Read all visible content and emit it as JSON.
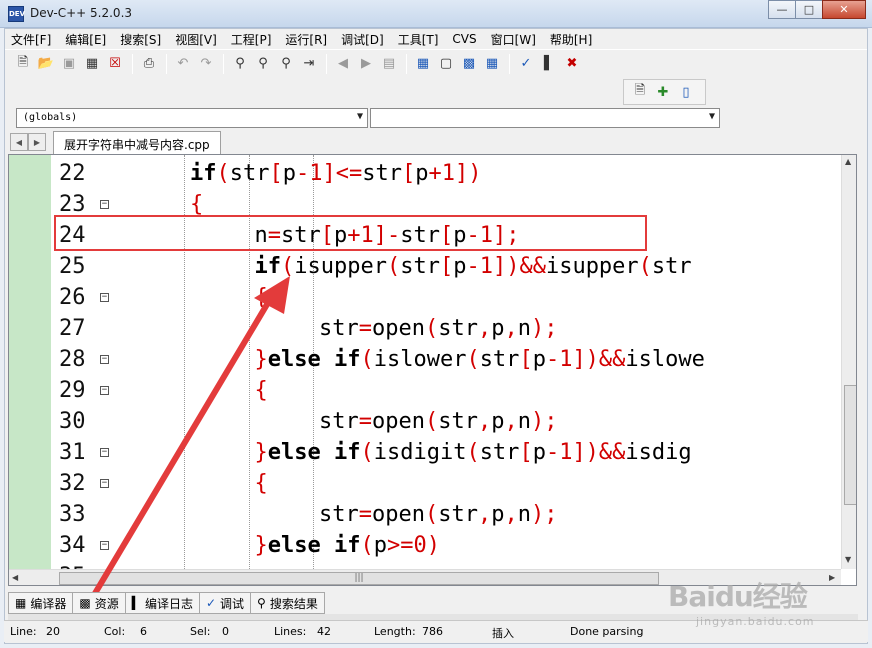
{
  "window": {
    "title": "Dev-C++ 5.2.0.3",
    "icon": "devcpp-app-icon",
    "controls": [
      "minimize",
      "maximize",
      "close"
    ]
  },
  "menu": [
    "文件[F]",
    "编辑[E]",
    "搜索[S]",
    "视图[V]",
    "工程[P]",
    "运行[R]",
    "调试[D]",
    "工具[T]",
    "CVS",
    "窗口[W]",
    "帮助[H]"
  ],
  "toolbar": {
    "icons": [
      "new-file-icon",
      "open-file-icon",
      "save-icon",
      "save-all-icon",
      "close-file-icon",
      "print-icon",
      "undo-icon",
      "redo-icon",
      "find-icon",
      "replace-icon",
      "find-next-icon",
      "goto-line-icon",
      "bookmark-back-icon",
      "bookmark-forward-icon",
      "toggle-bookmark-icon",
      "compile-icon",
      "run-icon",
      "compile-run-icon",
      "rebuild-icon",
      "check-syntax-icon",
      "profile-icon",
      "stop-icon"
    ],
    "secondary_icons": [
      "add-to-project-icon",
      "new-class-icon",
      "project-options-icon"
    ]
  },
  "combos": {
    "scope": "(globals)",
    "members": ""
  },
  "tabs": {
    "file": "展开字符串中减号内容.cpp"
  },
  "editor": {
    "lines": [
      {
        "n": "22",
        "fold": false,
        "indent": 3,
        "tokens": [
          [
            "kw",
            "if"
          ],
          [
            "op",
            "("
          ],
          [
            "id",
            "str"
          ],
          [
            "op",
            "["
          ],
          [
            "id",
            "p"
          ],
          [
            "op",
            "-"
          ],
          [
            "num",
            "1"
          ],
          [
            "op",
            "]<="
          ],
          [
            "id",
            "str"
          ],
          [
            "op",
            "["
          ],
          [
            "id",
            "p"
          ],
          [
            "op",
            "+"
          ],
          [
            "num",
            "1"
          ],
          [
            "op",
            "])"
          ]
        ]
      },
      {
        "n": "23",
        "fold": true,
        "indent": 3,
        "tokens": [
          [
            "op",
            "{"
          ]
        ]
      },
      {
        "n": "24",
        "fold": false,
        "indent": 4,
        "tokens": [
          [
            "id",
            "n"
          ],
          [
            "op",
            "="
          ],
          [
            "id",
            "str"
          ],
          [
            "op",
            "["
          ],
          [
            "id",
            "p"
          ],
          [
            "op",
            "+"
          ],
          [
            "num",
            "1"
          ],
          [
            "op",
            "]-"
          ],
          [
            "id",
            "str"
          ],
          [
            "op",
            "["
          ],
          [
            "id",
            "p"
          ],
          [
            "op",
            "-"
          ],
          [
            "num",
            "1"
          ],
          [
            "op",
            "];"
          ]
        ]
      },
      {
        "n": "25",
        "fold": false,
        "indent": 4,
        "tokens": [
          [
            "kw",
            "if"
          ],
          [
            "op",
            "("
          ],
          [
            "id",
            "isupper"
          ],
          [
            "op",
            "("
          ],
          [
            "id",
            "str"
          ],
          [
            "op",
            "["
          ],
          [
            "id",
            "p"
          ],
          [
            "op",
            "-"
          ],
          [
            "num",
            "1"
          ],
          [
            "op",
            "])&&"
          ],
          [
            "id",
            "isupper"
          ],
          [
            "op",
            "("
          ],
          [
            "id",
            "str"
          ]
        ]
      },
      {
        "n": "26",
        "fold": true,
        "indent": 4,
        "tokens": [
          [
            "op",
            "{"
          ]
        ]
      },
      {
        "n": "27",
        "fold": false,
        "indent": 5,
        "tokens": [
          [
            "id",
            "str"
          ],
          [
            "op",
            "="
          ],
          [
            "id",
            "open"
          ],
          [
            "op",
            "("
          ],
          [
            "id",
            "str"
          ],
          [
            "op",
            ","
          ],
          [
            "id",
            "p"
          ],
          [
            "op",
            ","
          ],
          [
            "id",
            "n"
          ],
          [
            "op",
            ");"
          ]
        ]
      },
      {
        "n": "28",
        "fold": true,
        "indent": 4,
        "tokens": [
          [
            "op",
            "}"
          ],
          [
            "kw",
            "else if"
          ],
          [
            "op",
            "("
          ],
          [
            "id",
            "islower"
          ],
          [
            "op",
            "("
          ],
          [
            "id",
            "str"
          ],
          [
            "op",
            "["
          ],
          [
            "id",
            "p"
          ],
          [
            "op",
            "-"
          ],
          [
            "num",
            "1"
          ],
          [
            "op",
            "])&&"
          ],
          [
            "id",
            "islowe"
          ]
        ]
      },
      {
        "n": "29",
        "fold": true,
        "indent": 4,
        "tokens": [
          [
            "op",
            "{"
          ]
        ]
      },
      {
        "n": "30",
        "fold": false,
        "indent": 5,
        "tokens": [
          [
            "id",
            "str"
          ],
          [
            "op",
            "="
          ],
          [
            "id",
            "open"
          ],
          [
            "op",
            "("
          ],
          [
            "id",
            "str"
          ],
          [
            "op",
            ","
          ],
          [
            "id",
            "p"
          ],
          [
            "op",
            ","
          ],
          [
            "id",
            "n"
          ],
          [
            "op",
            ");"
          ]
        ]
      },
      {
        "n": "31",
        "fold": true,
        "indent": 4,
        "tokens": [
          [
            "op",
            "}"
          ],
          [
            "kw",
            "else if"
          ],
          [
            "op",
            "("
          ],
          [
            "id",
            "isdigit"
          ],
          [
            "op",
            "("
          ],
          [
            "id",
            "str"
          ],
          [
            "op",
            "["
          ],
          [
            "id",
            "p"
          ],
          [
            "op",
            "-"
          ],
          [
            "num",
            "1"
          ],
          [
            "op",
            "])&&"
          ],
          [
            "id",
            "isdig"
          ]
        ]
      },
      {
        "n": "32",
        "fold": true,
        "indent": 4,
        "tokens": [
          [
            "op",
            "{"
          ]
        ]
      },
      {
        "n": "33",
        "fold": false,
        "indent": 5,
        "tokens": [
          [
            "id",
            "str"
          ],
          [
            "op",
            "="
          ],
          [
            "id",
            "open"
          ],
          [
            "op",
            "("
          ],
          [
            "id",
            "str"
          ],
          [
            "op",
            ","
          ],
          [
            "id",
            "p"
          ],
          [
            "op",
            ","
          ],
          [
            "id",
            "n"
          ],
          [
            "op",
            ");"
          ]
        ]
      },
      {
        "n": "34",
        "fold": true,
        "indent": 4,
        "tokens": [
          [
            "op",
            "}"
          ],
          [
            "kw",
            "else if"
          ],
          [
            "op",
            "("
          ],
          [
            "id",
            "p"
          ],
          [
            "op",
            ">="
          ],
          [
            "num",
            "0"
          ],
          [
            "op",
            ")"
          ]
        ]
      },
      {
        "n": "35",
        "fold": false,
        "indent": 4,
        "tokens": []
      }
    ],
    "highlighted_line": "24",
    "colors": {
      "keyword": "#000000",
      "operator": "#d20000",
      "gutter_bg": "#c7e7c7",
      "annotation": "#e33b3b"
    }
  },
  "bottom_tabs": [
    {
      "icon": "compiler-icon",
      "label": "编译器"
    },
    {
      "icon": "resources-icon",
      "label": "资源"
    },
    {
      "icon": "compile-log-icon",
      "label": "编译日志"
    },
    {
      "icon": "debug-icon",
      "label": "调试"
    },
    {
      "icon": "search-results-icon",
      "label": "搜索结果"
    }
  ],
  "status": {
    "line_label": "Line:",
    "line": "20",
    "col_label": "Col:",
    "col": "6",
    "sel_label": "Sel:",
    "sel": "0",
    "lines_label": "Lines:",
    "lines": "42",
    "length_label": "Length:",
    "length": "786",
    "mode": "插入",
    "message": "Done parsing"
  },
  "watermark": {
    "main": "Baidu经验",
    "sub": "jingyan.baidu.com"
  }
}
